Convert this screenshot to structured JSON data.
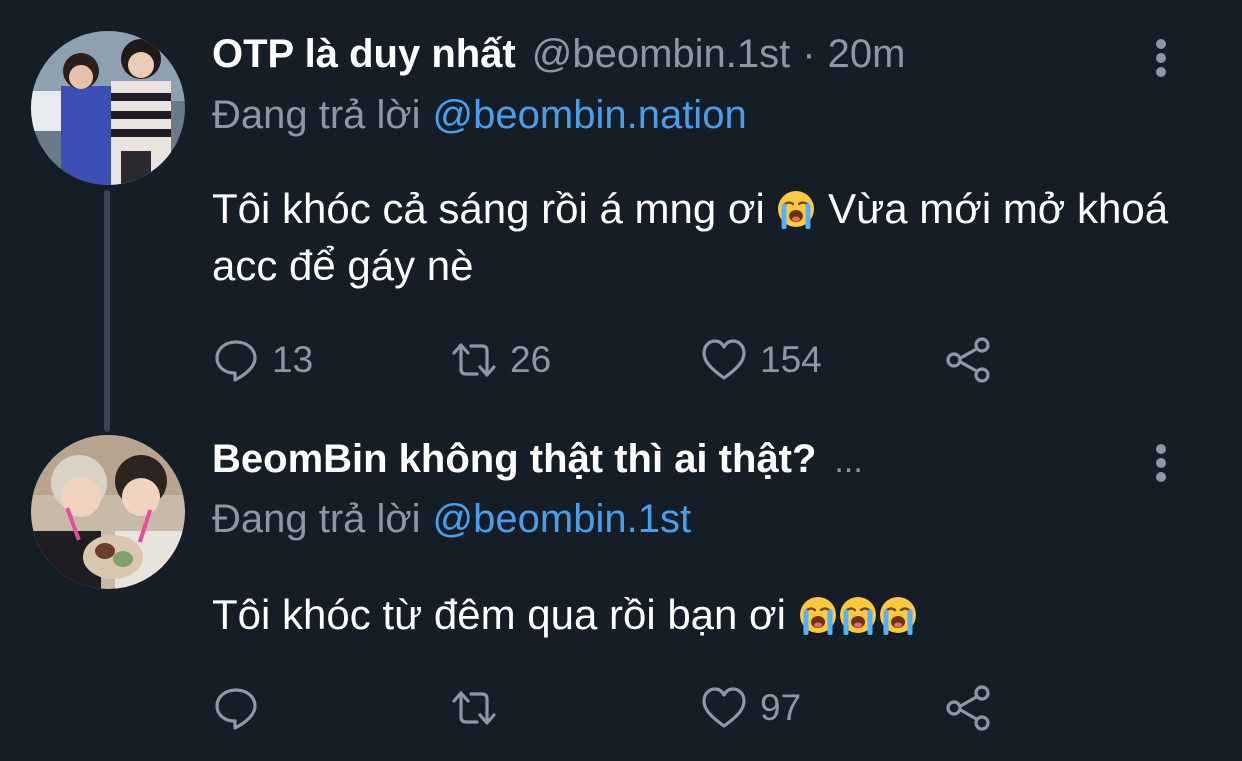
{
  "colors": {
    "background": "#151d27",
    "text_primary": "#ffffff",
    "text_secondary": "#8b98a5",
    "link": "#4a9fec",
    "thread_line": "#3a4450"
  },
  "tweets": [
    {
      "display_name": "OTP là duy nhất",
      "handle": "@beombin.1st",
      "separator": "·",
      "time": "20m",
      "reply_prefix": "Đang trả lời",
      "reply_to": "@beombin.nation",
      "text_before_emoji": "Tôi khóc cả sáng rồi á mng ơi ",
      "emoji": "loudly-crying-face",
      "text_after_emoji": " Vừa mới mở khoá acc để gáy nè",
      "actions": {
        "reply_count": "13",
        "retweet_count": "26",
        "like_count": "154"
      }
    },
    {
      "display_name": "BeomBin không thật thì ai thật?",
      "name_truncation": "...",
      "reply_prefix": "Đang trả lời",
      "reply_to": "@beombin.1st",
      "text_before_emoji": "Tôi khóc từ đêm qua rồi bạn ơi ",
      "emoji": "loudly-crying-face",
      "emoji_count": 3,
      "actions": {
        "reply_count": "",
        "retweet_count": "",
        "like_count": "97"
      }
    }
  ],
  "icons": {
    "reply": "speech-bubble-icon",
    "retweet": "retweet-arrows-icon",
    "like": "heart-icon",
    "share": "share-nodes-icon",
    "more": "vertical-ellipsis-icon"
  }
}
